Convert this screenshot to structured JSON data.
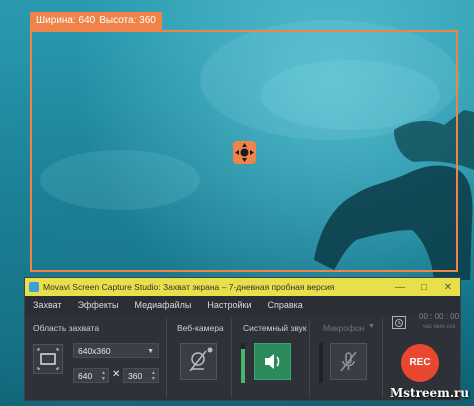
{
  "capture": {
    "width_label": "Ширина: 640",
    "height_label": "Высота: 360"
  },
  "colors": {
    "accent": "#f0834a",
    "titlebar": "#e8e04a",
    "window": "#2e3238",
    "rec": "#e9472f",
    "audio_active": "#2a8a5c",
    "level": "#46b86a"
  },
  "app": {
    "title": "Movavi Screen Capture Studio: Захват экрана – 7-дневная пробная версия",
    "window_controls": [
      "—",
      "□",
      "✕"
    ],
    "menu": [
      "Захват",
      "Эффекты",
      "Медиафайлы",
      "Настройки",
      "Справка"
    ],
    "timer": {
      "value": "00 : 00 : 00",
      "units": "час   мин   сек"
    },
    "capture_area": {
      "label": "Область захвата",
      "preset": "640x360",
      "width": "640",
      "height": "360",
      "times": "✕"
    },
    "webcam": {
      "label": "Веб-камера",
      "icon": "webcam-off-icon"
    },
    "system_sound": {
      "label": "Системный звук",
      "icon": "speaker-icon",
      "level": 0.85
    },
    "microphone": {
      "label": "Микрофон",
      "icon": "microphone-off-icon",
      "level": 0.0
    },
    "rec_label": "REC"
  },
  "watermark": "Mstreem.ru"
}
